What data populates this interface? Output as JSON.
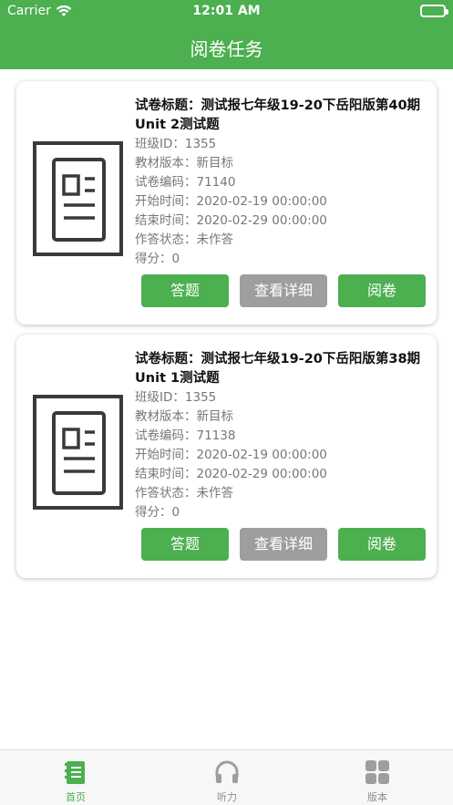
{
  "status_bar": {
    "carrier": "Carrier",
    "time": "12:01 AM"
  },
  "header": {
    "title": "阅卷任务"
  },
  "tasks": [
    {
      "title": "试卷标题：测试报七年级19-20下岳阳版第40期Unit 2测试题",
      "class_id": "班级ID：1355",
      "edition": "教材版本：新目标",
      "paper_code": "试卷编码：71140",
      "start_time": "开始时间：2020-02-19 00:00:00",
      "end_time": "结束时间：2020-02-29 00:00:00",
      "answer_status": "作答状态：未作答",
      "score": "得分：0",
      "buttons": {
        "answer": "答题",
        "detail": "查看详细",
        "grade": "阅卷"
      }
    },
    {
      "title": "试卷标题：测试报七年级19-20下岳阳版第38期Unit 1测试题",
      "class_id": "班级ID：1355",
      "edition": "教材版本：新目标",
      "paper_code": "试卷编码：71138",
      "start_time": "开始时间：2020-02-19 00:00:00",
      "end_time": "结束时间：2020-02-29 00:00:00",
      "answer_status": "作答状态：未作答",
      "score": "得分：0",
      "buttons": {
        "answer": "答题",
        "detail": "查看详细",
        "grade": "阅卷"
      }
    }
  ],
  "tabbar": {
    "home": "首页",
    "listening": "听力",
    "version": "版本"
  },
  "colors": {
    "brand": "#4caf50",
    "disabled": "#9e9e9e",
    "inactive_tab": "#8e8e8e"
  },
  "icons": {
    "home": "document-list-icon",
    "listening": "headphones-icon",
    "version": "grid-icon",
    "thumbnail": "document-icon"
  }
}
